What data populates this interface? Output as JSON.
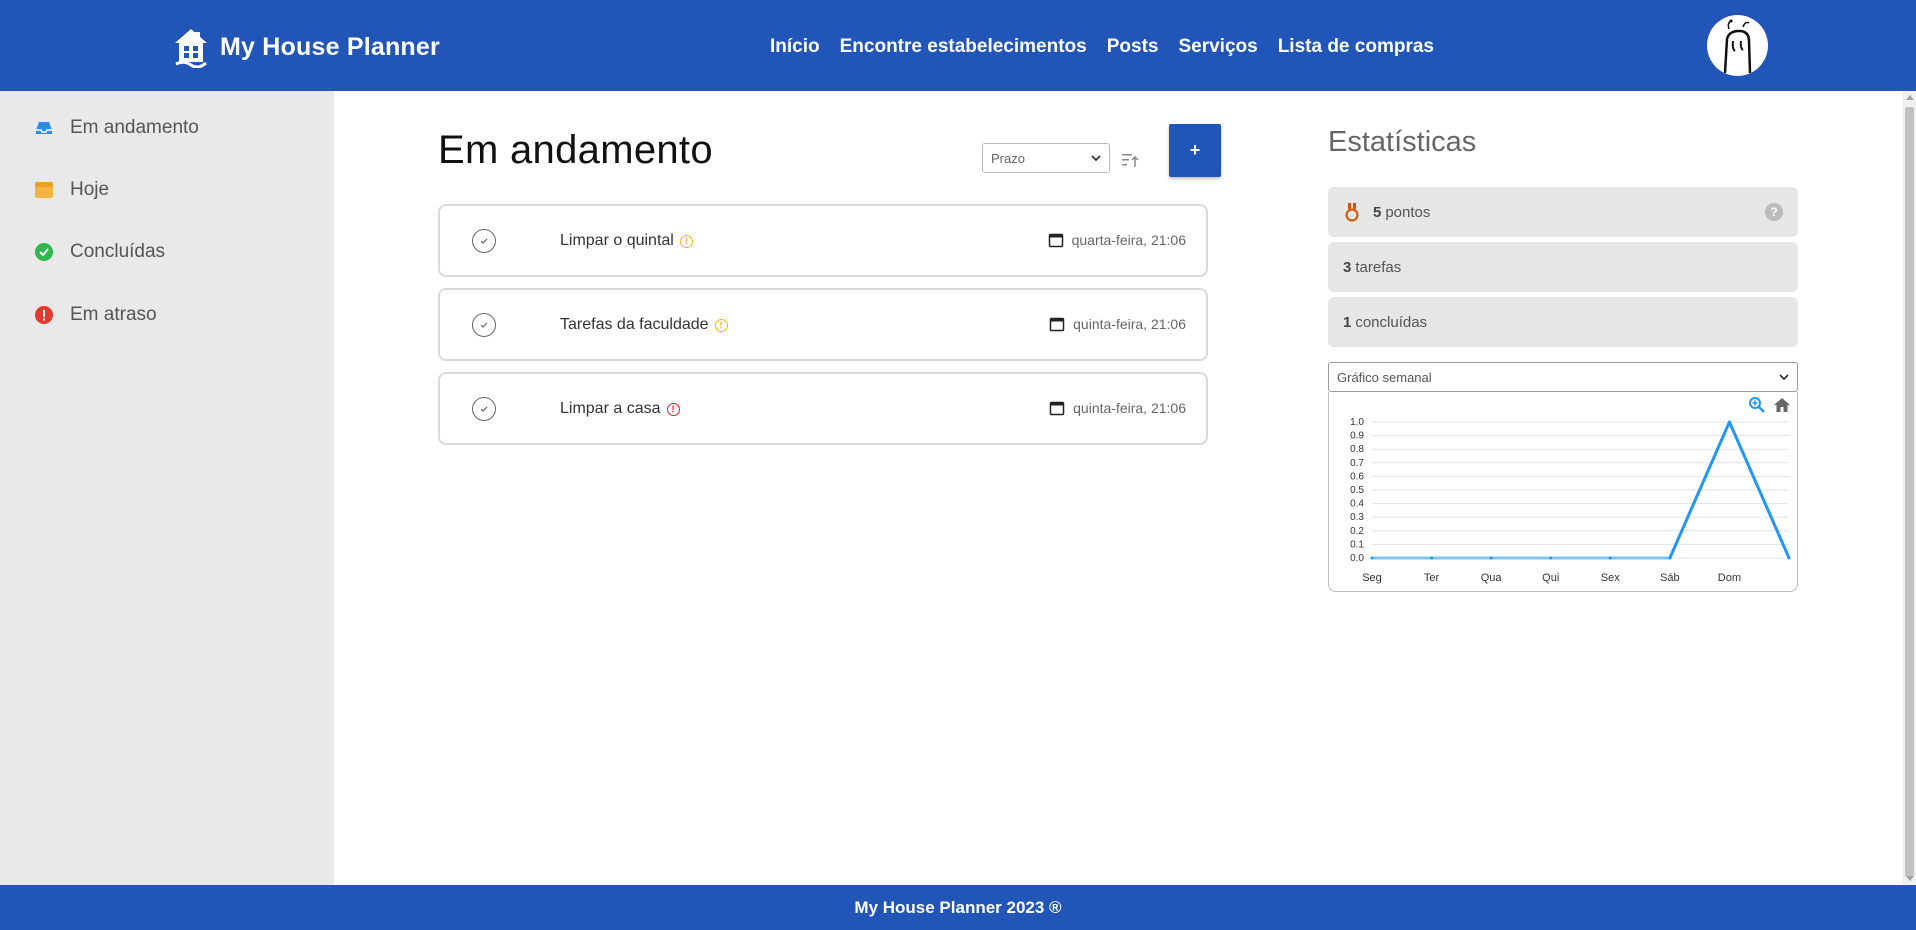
{
  "header": {
    "brand": "My House Planner",
    "nav": [
      "Início",
      "Encontre estabelecimentos",
      "Posts",
      "Serviços",
      "Lista de compras"
    ]
  },
  "sidebar": {
    "items": [
      {
        "label": "Em andamento",
        "icon": "inbox-icon",
        "color": "#2f8be6"
      },
      {
        "label": "Hoje",
        "icon": "calendar-today-icon",
        "color": "#f5b342"
      },
      {
        "label": "Concluídas",
        "icon": "check-circle-icon",
        "color": "#2db84d"
      },
      {
        "label": "Em atraso",
        "icon": "alert-circle-icon",
        "color": "#e23b2e"
      }
    ]
  },
  "main": {
    "title": "Em andamento",
    "sort_select": "Prazo",
    "add_button": "+",
    "tasks": [
      {
        "title": "Limpar o quintal",
        "priority_color": "#f5b800",
        "date": "quarta-feira, 21:06"
      },
      {
        "title": "Tarefas da faculdade",
        "priority_color": "#f5b800",
        "date": "quinta-feira, 21:06"
      },
      {
        "title": "Limpar a casa",
        "priority_color": "#e02020",
        "date": "quinta-feira, 21:06"
      }
    ]
  },
  "stats": {
    "title": "Estatísticas",
    "points": {
      "value": "5",
      "label": "pontos"
    },
    "tasks": {
      "value": "3",
      "label": "tarefas"
    },
    "completed": {
      "value": "1",
      "label": "concluídas"
    },
    "help": "?",
    "chart_select": "Gráfico semanal"
  },
  "chart_data": {
    "type": "line",
    "categories": [
      "Seg",
      "Ter",
      "Qua",
      "Qui",
      "Sex",
      "Sáb",
      "Dom"
    ],
    "x_values": [
      0,
      1,
      2,
      3,
      4,
      5,
      6,
      7
    ],
    "values": [
      0,
      0,
      0,
      0,
      0,
      0,
      1,
      0
    ],
    "yticks": [
      "0.0",
      "0.1",
      "0.2",
      "0.3",
      "0.4",
      "0.5",
      "0.6",
      "0.7",
      "0.8",
      "0.9",
      "1.0"
    ],
    "ylim": [
      0,
      1
    ],
    "grid": true,
    "line_color": "#2196f3"
  },
  "footer": {
    "text": "My House Planner 2023 ®"
  }
}
